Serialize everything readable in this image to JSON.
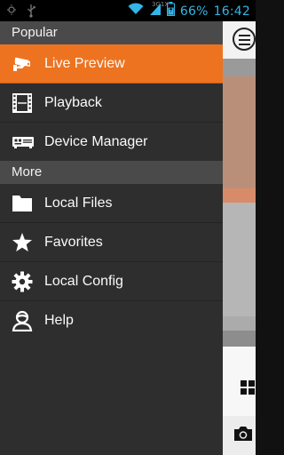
{
  "status_bar": {
    "network_label": "3G1X",
    "battery": "66%",
    "time": "16:42",
    "icons": [
      "brightness-icon",
      "usb-icon",
      "wifi-icon",
      "signal-icon",
      "battery-icon"
    ]
  },
  "drawer": {
    "sections": [
      {
        "title": "Popular",
        "items": [
          {
            "label": "Live Preview",
            "icon": "cctv-camera-icon",
            "active": true
          },
          {
            "label": "Playback",
            "icon": "film-strip-icon",
            "active": false
          },
          {
            "label": "Device Manager",
            "icon": "dvr-device-icon",
            "active": false
          }
        ]
      },
      {
        "title": "More",
        "items": [
          {
            "label": "Local Files",
            "icon": "folder-icon",
            "active": false
          },
          {
            "label": "Favorites",
            "icon": "star-icon",
            "active": false
          },
          {
            "label": "Local Config",
            "icon": "gear-icon",
            "active": false
          },
          {
            "label": "Help",
            "icon": "help-person-icon",
            "active": false
          }
        ]
      }
    ]
  },
  "colors": {
    "accent": "#ed7320",
    "drawer_bg": "#2e2e2e",
    "section_bg": "#4a4a4a",
    "status_text": "#33b5e5"
  }
}
